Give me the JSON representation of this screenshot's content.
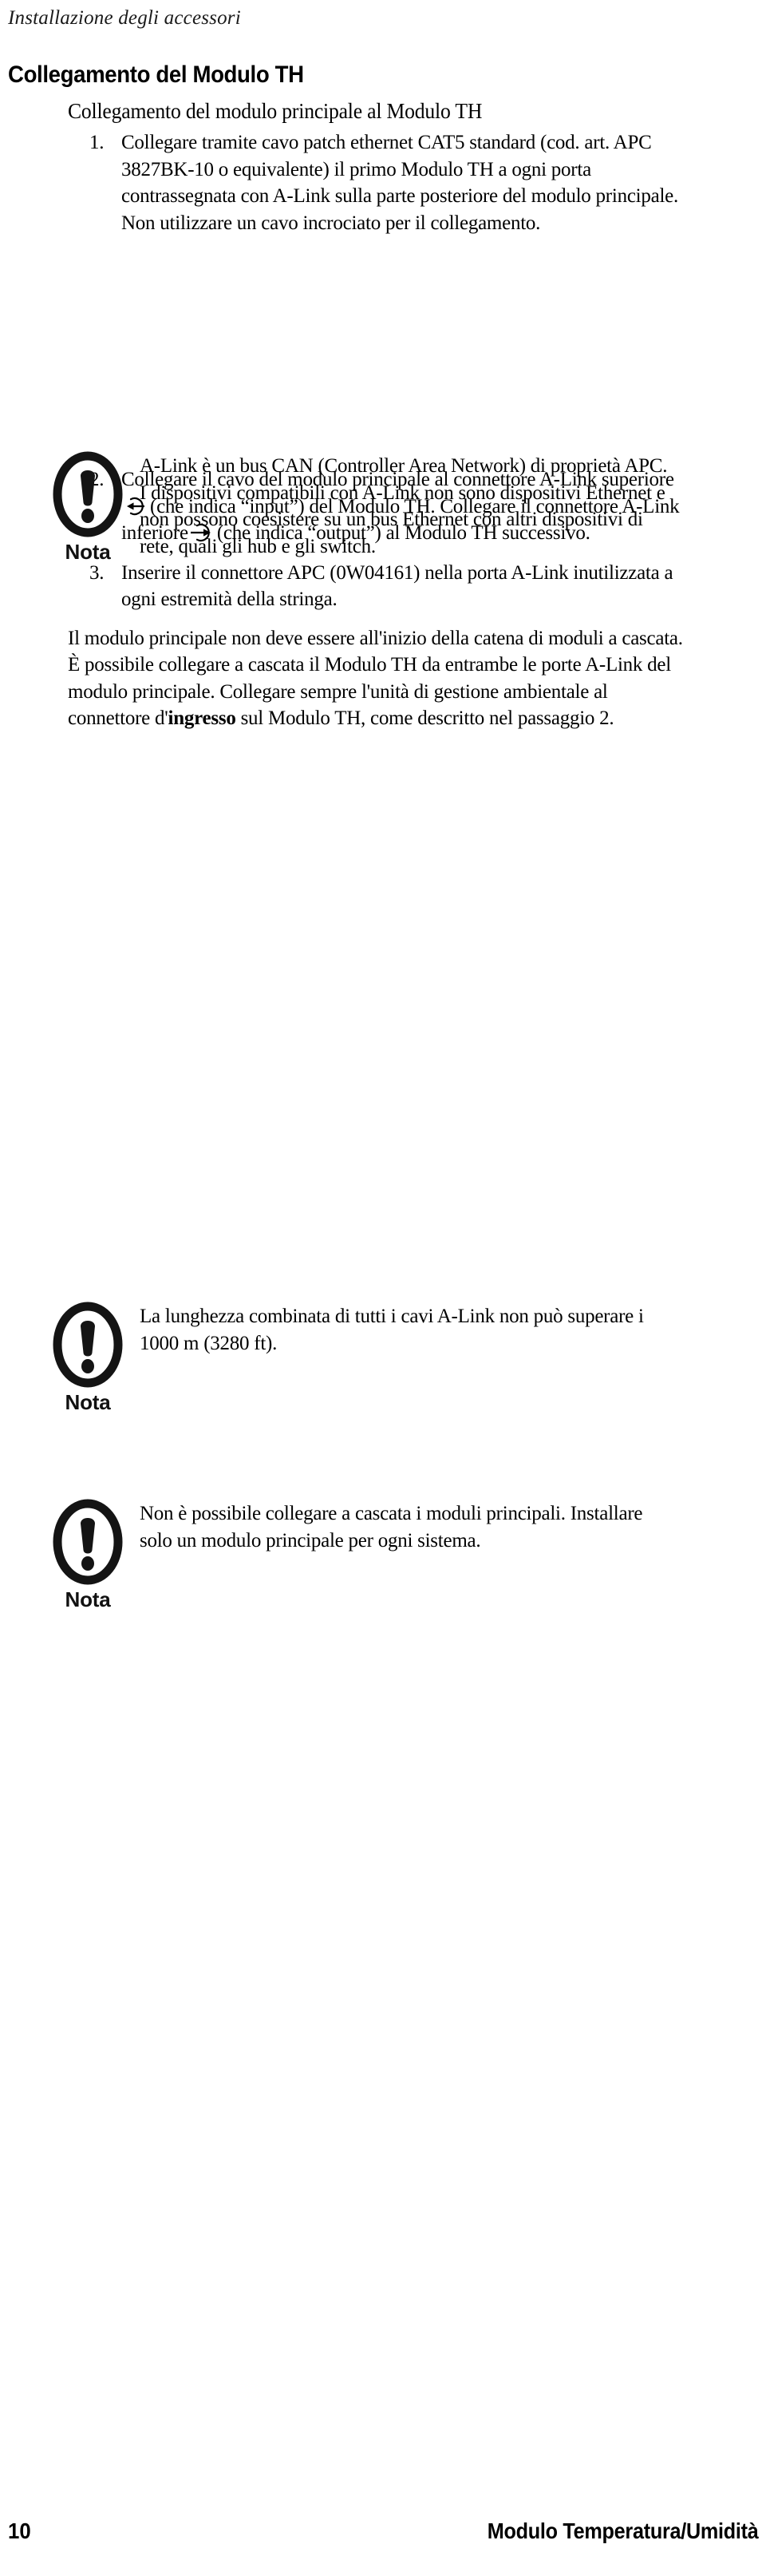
{
  "header": {
    "running_title": "Installazione degli accessori"
  },
  "section": {
    "title": "Collegamento del Modulo TH",
    "subtitle": "Collegamento del modulo principale al Modulo TH"
  },
  "steps": [
    {
      "number": "1.",
      "text": "Collegare tramite cavo patch ethernet CAT5 standard (cod. art. APC 3827BK-10 o equivalente) il primo Modulo TH a ogni porta contrassegnata con A-Link sulla parte posteriore del modulo principale. Non utilizzare un cavo incrociato per il collegamento."
    },
    {
      "number": "2.",
      "text_part1": "Collegare il cavo del modulo principale al connettore A-Link superiore",
      "text_part2": "(che indica “input”) del Modulo TH. Collegare il connettore A-Link inferiore",
      "text_part3": "(che indica “output”) al Modulo TH successivo.",
      "icon_input": "alink-input-icon",
      "icon_output": "alink-output-icon"
    },
    {
      "number": "3.",
      "text": "Inserire il connettore APC (0W04161) nella porta A-Link inutilizzata a ogni estremità della stringa."
    }
  ],
  "paragraph": {
    "part1": "Il modulo principale non deve essere all'inizio della catena di moduli a cascata. È possibile collegare a cascata il Modulo TH da entrambe le porte A-Link del modulo principale. Collegare sempre l'unità di gestione ambientale al connettore d'",
    "bold": "ingresso",
    "part2": " sul Modulo TH, come descritto nel passaggio 2."
  },
  "notes": [
    {
      "icon": "exclamation-oval-icon",
      "label": "Nota",
      "text": "A-Link è un bus CAN (Controller Area Network) di proprietà APC. I dispositivi compatibili con A-Link non sono dispositivi Ethernet e non possono coesistere su un bus Ethernet con altri dispositivi di rete, quali gli hub e gli switch."
    },
    {
      "icon": "exclamation-oval-icon",
      "label": "Nota",
      "text": "La lunghezza combinata di tutti i cavi A-Link non può superare i 1000 m (3280 ft)."
    },
    {
      "icon": "exclamation-oval-icon",
      "label": "Nota",
      "text": "Non è possibile collegare a cascata i moduli principali. Installare solo un modulo principale per ogni sistema."
    }
  ],
  "footer": {
    "page_number": "10",
    "document_title": "Modulo Temperatura/Umidità"
  },
  "colors": {
    "text": "#000000",
    "background": "#ffffff"
  }
}
